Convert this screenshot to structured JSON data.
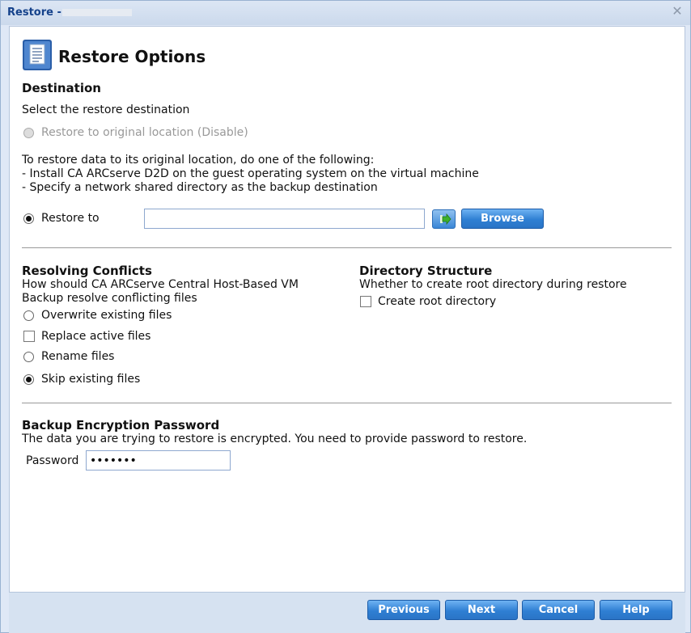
{
  "window": {
    "title": "Restore -",
    "close_glyph": "✕"
  },
  "header": {
    "icon": "document-icon",
    "title": "Restore Options"
  },
  "destination": {
    "heading": "Destination",
    "prompt": "Select the restore destination",
    "original_option": "Restore to original location (Disable)",
    "info_lines": [
      "To restore data to its original location, do one of the following:",
      "- Install CA ARCserve D2D on the guest operating system on the virtual machine",
      "- Specify a network shared directory as the backup destination"
    ],
    "restore_to_label": "Restore to",
    "restore_to_value": "",
    "browse_label": "Browse"
  },
  "conflicts": {
    "heading": "Resolving Conflicts",
    "desc_lines": [
      "How should CA ARCserve Central Host-Based VM",
      "Backup  resolve conflicting files"
    ],
    "options": [
      {
        "label": "Overwrite existing files",
        "kind": "radio",
        "selected": false
      },
      {
        "label": "Replace active files",
        "kind": "checkbox",
        "selected": false
      },
      {
        "label": "Rename files",
        "kind": "radio",
        "selected": false
      },
      {
        "label": "Skip existing files",
        "kind": "radio",
        "selected": true
      }
    ]
  },
  "directory": {
    "heading": "Directory Structure",
    "desc": "Whether to create root directory during restore",
    "option": "Create root directory"
  },
  "encryption": {
    "heading": "Backup Encryption Password",
    "desc": "The data you are trying to restore is encrypted. You need to provide password to restore.",
    "password_label": "Password",
    "password_value": "•••••••"
  },
  "footer": {
    "previous": "Previous",
    "next": "Next",
    "cancel": "Cancel",
    "help": "Help"
  },
  "colors": {
    "accent": "#2f7fd3",
    "title_text": "#15428b"
  }
}
